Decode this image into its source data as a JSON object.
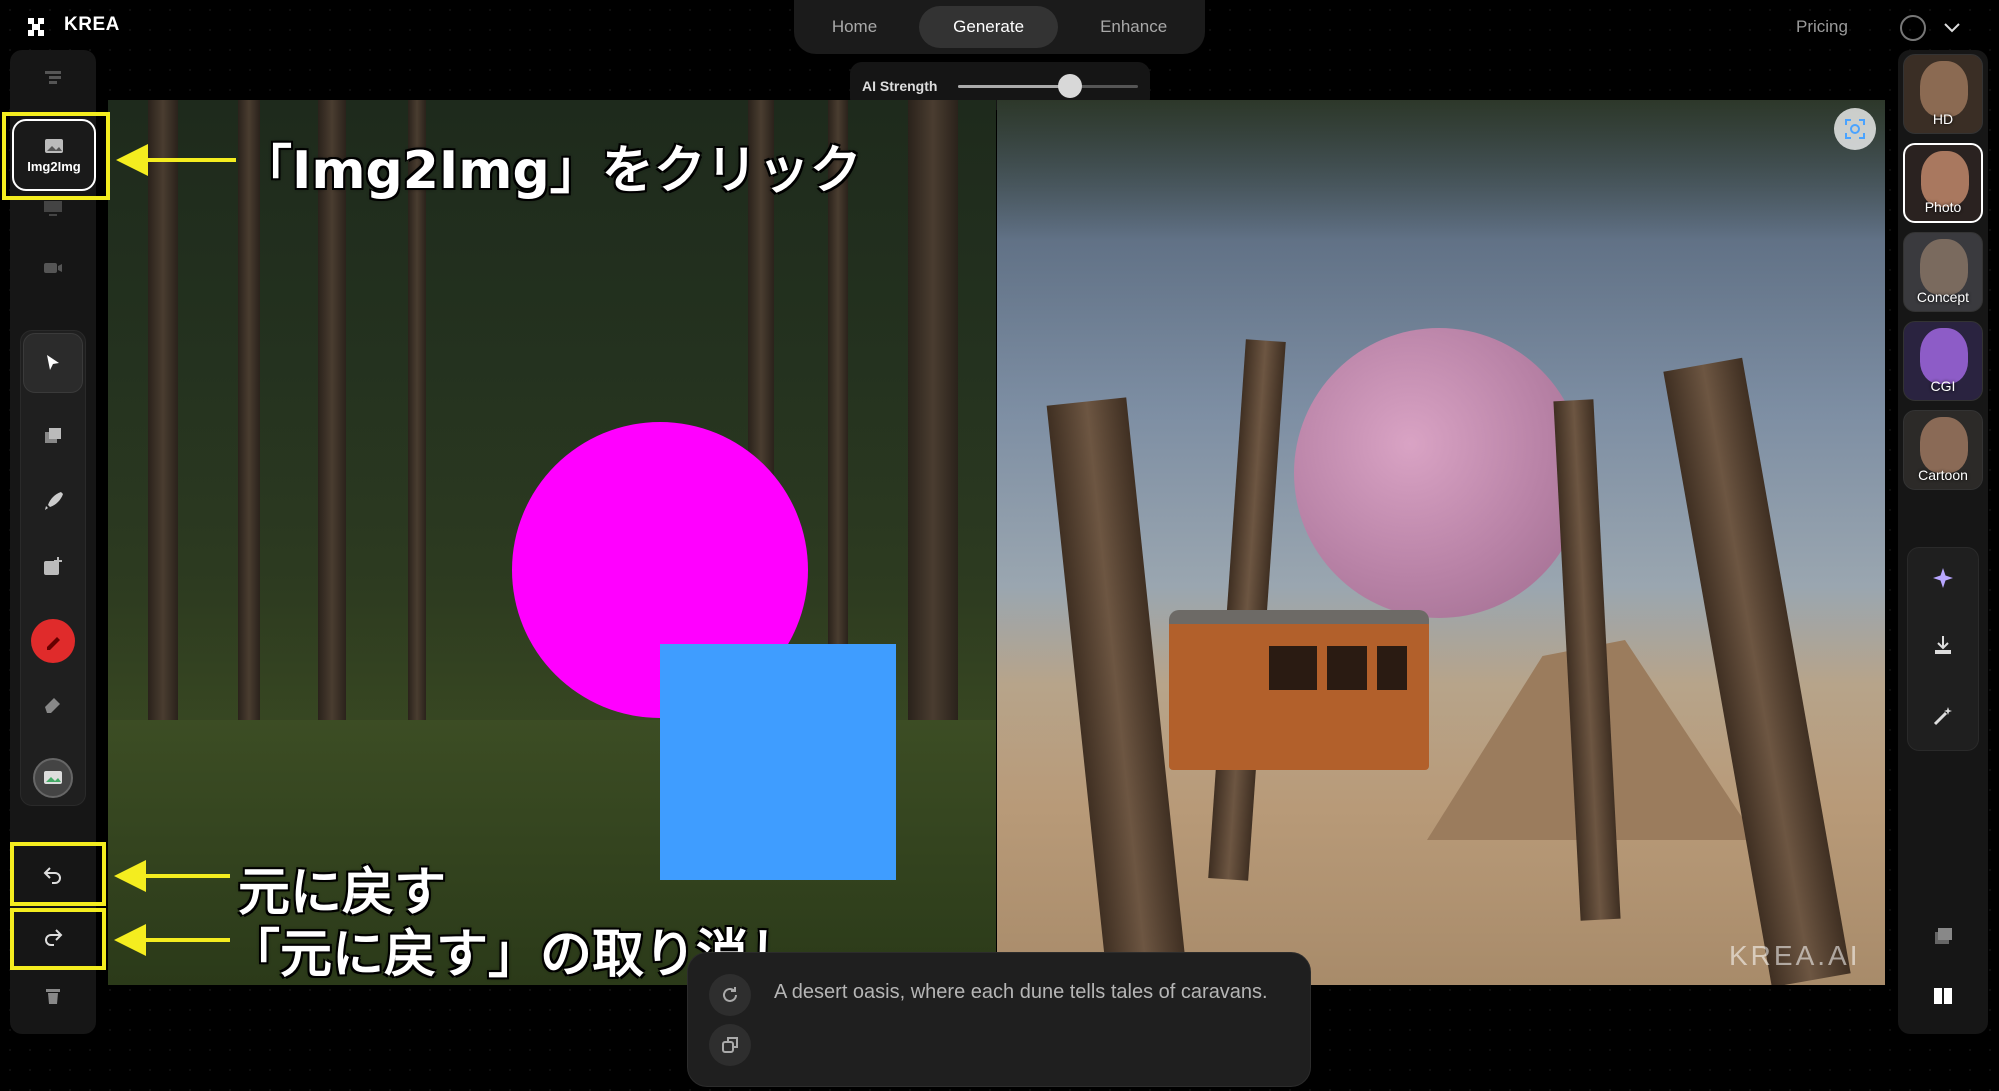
{
  "app": {
    "brand": "KREA"
  },
  "nav": {
    "tabs": [
      {
        "label": "Home",
        "active": false
      },
      {
        "label": "Generate",
        "active": true
      },
      {
        "label": "Enhance",
        "active": false
      }
    ],
    "pricing": "Pricing"
  },
  "strength": {
    "label": "AI Strength",
    "value": 0.62
  },
  "left_toolbar": {
    "img2img_label": "Img2Img",
    "icons": [
      "text-to-image-icon",
      "img2img-icon",
      "screen-icon",
      "video-icon",
      "pointer-icon",
      "layers-icon",
      "brush-icon",
      "add-image-icon",
      "color-picker-icon",
      "eraser-icon",
      "background-icon",
      "undo-icon",
      "redo-icon",
      "trash-icon"
    ]
  },
  "annotations": {
    "img2img": "「Img2Img」をクリック",
    "undo": "元に戻す",
    "redo": "「元に戻す」の取り消し",
    "highlight_color": "#f4ed1f"
  },
  "canvas": {
    "shape_colors": {
      "circle": "#ff00ff",
      "square": "#3f9dff"
    },
    "watermark": "KREA.AI"
  },
  "prompt": {
    "text": "A desert oasis, where each dune tells tales of caravans."
  },
  "styles": [
    {
      "label": "HD",
      "active": false
    },
    {
      "label": "Photo",
      "active": true
    },
    {
      "label": "Concept",
      "active": false
    },
    {
      "label": "CGI",
      "active": false
    },
    {
      "label": "Cartoon",
      "active": false
    }
  ],
  "right_actions": [
    "sparkle-icon",
    "download-icon",
    "magic-wand-icon",
    "layers-icon",
    "split-view-icon"
  ]
}
